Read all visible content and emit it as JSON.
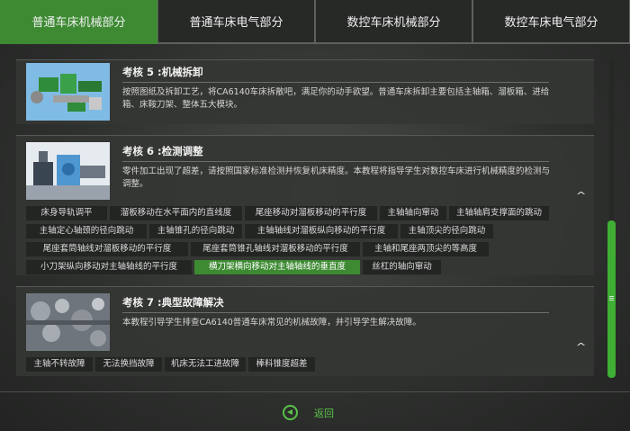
{
  "tabs": [
    {
      "label": "普通车床机械部分",
      "active": true
    },
    {
      "label": "普通车床电气部分",
      "active": false
    },
    {
      "label": "数控车床机械部分",
      "active": false
    },
    {
      "label": "数控车床电气部分",
      "active": false
    }
  ],
  "cards": [
    {
      "title": "考核 5 :机械拆卸",
      "desc": "按照图纸及拆卸工艺，将CA6140车床拆散吧，满足你的动手欲望。普通车床拆卸主要包括主轴箱、溜板箱、进给箱、床鞍刀架、整体五大模块。",
      "chips": []
    },
    {
      "title": "考核 6 :检测调整",
      "desc": "零件加工出现了超差，请按照国家标准检测并恢复机床精度。本教程将指导学生对数控车床进行机械精度的检测与调整。",
      "chips": [
        {
          "label": "床身导轨调平"
        },
        {
          "label": "溜板移动在水平面内的直线度"
        },
        {
          "label": "尾座移动对溜板移动的平行度"
        },
        {
          "label": "主轴轴向窜动"
        },
        {
          "label": "主轴轴肩支撑面的跳动"
        },
        {
          "label": "主轴定心轴颈的径向跳动"
        },
        {
          "label": "主轴锥孔的径向跳动"
        },
        {
          "label": "主轴轴线对溜板纵向移动的平行度"
        },
        {
          "label": "主轴顶尖的径向跳动"
        },
        {
          "label": "尾座套筒轴线对溜板移动的平行度"
        },
        {
          "label": "尾座套筒锥孔轴线对溜板移动的平行度"
        },
        {
          "label": "主轴和尾座两顶尖的等高度"
        },
        {
          "label": "小刀架纵向移动对主轴轴线的平行度"
        },
        {
          "label": "横刀架横向移动对主轴轴线的垂直度",
          "selected": true
        },
        {
          "label": "丝杠的轴向窜动"
        }
      ]
    },
    {
      "title": "考核 7 :典型故障解决",
      "desc": "本教程引导学生排查CA6140普通车床常见的机械故障，并引导学生解决故障。",
      "chips": [
        {
          "label": "主轴不转故障"
        },
        {
          "label": "无法换挡故障"
        },
        {
          "label": "机床无法工进故障"
        },
        {
          "label": "棒料锥度超差"
        }
      ]
    }
  ],
  "footer": {
    "back_label": "返回"
  },
  "colors": {
    "accent": "#3d8a32",
    "accent_bright": "#5cc04a",
    "scroll_thumb": "#3fae34"
  }
}
